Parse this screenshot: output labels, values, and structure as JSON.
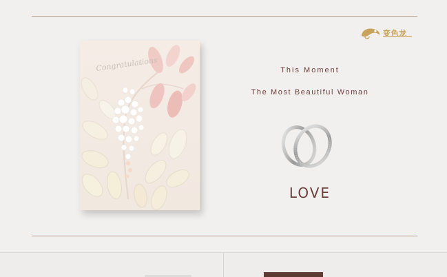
{
  "logo": {
    "text": "变色龙",
    "icon": "chameleon-logo-icon",
    "color": "#c9a35b"
  },
  "headline": "This Moment",
  "subheadline": "The Most Beautiful Woman",
  "love": "LOVE",
  "card": {
    "script_text": "Congratulations"
  },
  "rings_icon": "rings-icon",
  "colors": {
    "text": "#6b3f3a",
    "rule": "#b39a84",
    "background": "#f1f0ef"
  }
}
